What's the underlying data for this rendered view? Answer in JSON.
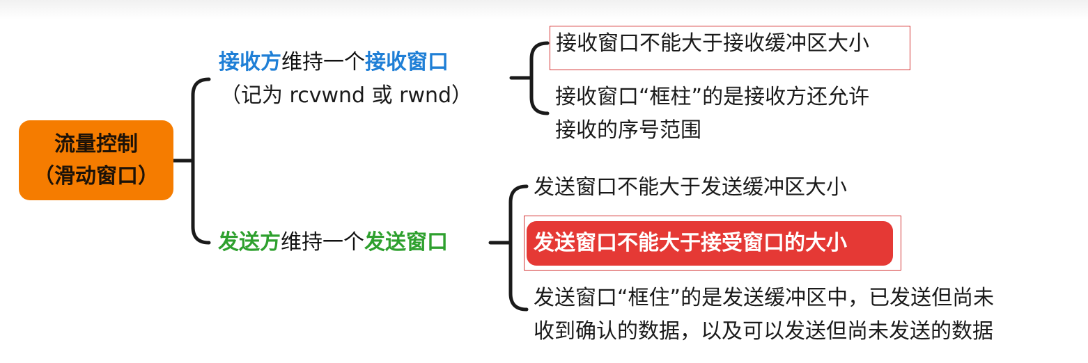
{
  "root": {
    "line1": "流量控制",
    "line2": "（滑动窗口）"
  },
  "receiver": {
    "part1": "接收方",
    "part2": "维持一个",
    "part3": "接收窗口",
    "note": "（记为 rcvwnd 或 rwnd）",
    "children": [
      {
        "text": "接收窗口不能大于接收缓冲区大小"
      },
      {
        "line1": "接收窗口“框柱”的是接收方还允许",
        "line2": "接收的序号范围"
      }
    ]
  },
  "sender": {
    "part1": "发送方",
    "part2": "维持一个",
    "part3": "发送窗口",
    "children": [
      {
        "text": "发送窗口不能大于发送缓冲区大小"
      },
      {
        "text": "发送窗口不能大于接受窗口的大小"
      },
      {
        "line1": "发送窗口“框住”的是发送缓冲区中，已发送但尚未",
        "line2": "收到确认的数据，以及可以发送但尚未发送的数据"
      }
    ]
  },
  "colors": {
    "root": "#f57c00",
    "receiver": "#1f7fd6",
    "sender": "#2ea02e",
    "highlight": "#e53935",
    "box": "#d32f2f"
  }
}
